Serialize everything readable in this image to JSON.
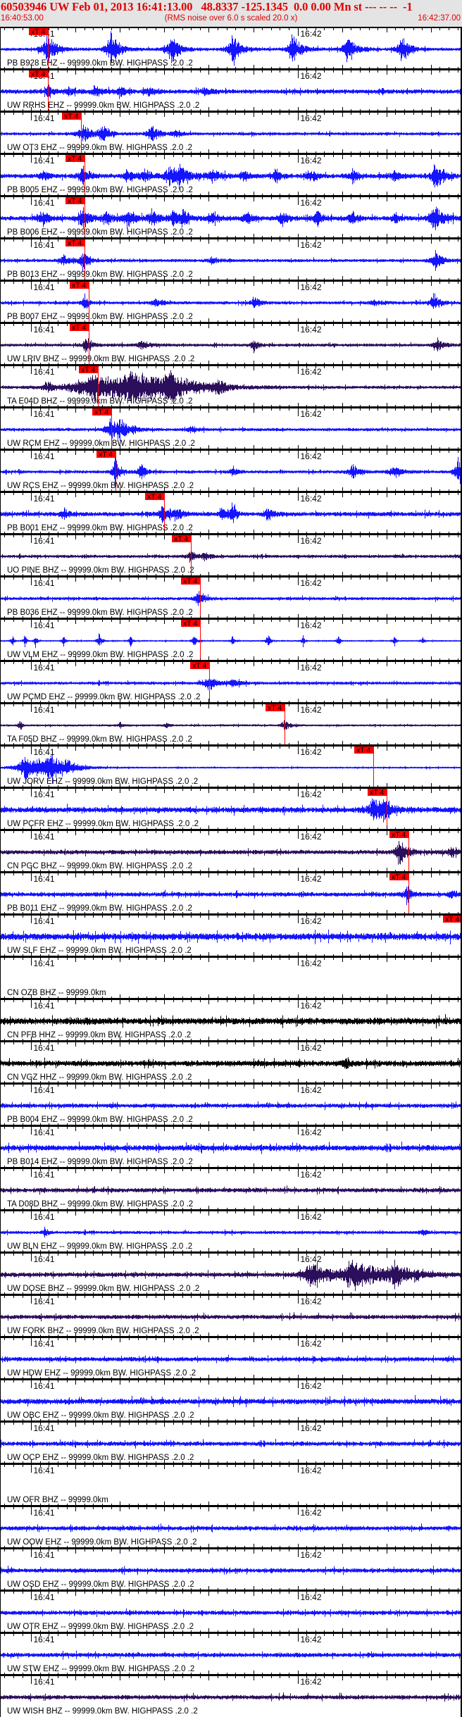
{
  "header": {
    "title": "60503946 UW Feb 01, 2013 16:41:13.00   48.8337 -125.1345  0.0 0.00 Mn st --- -- --  -1",
    "start_time": "16:40:53.00",
    "note": "(RMS noise over 6.0 s scaled 20.0 x)",
    "end_time": "16:42:37.00",
    "text_color": "#e00000",
    "background": "#e4e4e4"
  },
  "chart_data": {
    "type": "line",
    "x_axis": {
      "range": [
        "16:40:53.00",
        "16:42:37.00"
      ],
      "minor_tick_s": 2,
      "major_tick_s": 10,
      "tick_labels": [
        "16:41",
        "16:42"
      ]
    },
    "pick_label": "xT 4",
    "pick_color": "#ff0000",
    "panels": [
      {
        "label": "PB B928 EHZ -- 99999.0km BW. HIGHPASS .2.0 .2",
        "color": "#1414ff",
        "pick": "16:41:03.8"
      },
      {
        "label": "UW RRHS EHZ -- 99999.0km BW. HIGHPASS .2.0 .2",
        "color": "#1414ff",
        "pick": "16:41:03.8"
      },
      {
        "label": "UW OT3 EHZ -- 99999.0km BW. HIGHPASS .2.0 .2",
        "color": "#1414ff",
        "pick": "16:41:11.2"
      },
      {
        "label": "PB B005 EHZ -- 99999.0km BW. HIGHPASS .2.0 .2",
        "color": "#1414ff",
        "pick": "16:41:12.0"
      },
      {
        "label": "PB B006 EHZ -- 99999.0km BW. HIGHPASS .2.0 .2",
        "color": "#1414ff",
        "pick": "16:41:12.0"
      },
      {
        "label": "PB B013 EHZ -- 99999.0km BW. HIGHPASS .2.0 .2",
        "color": "#1414ff",
        "pick": "16:41:12.0"
      },
      {
        "label": "PB B007 EHZ -- 99999.0km BW. HIGHPASS .2.0 .2",
        "color": "#1414ff",
        "pick": "16:41:13.0"
      },
      {
        "label": "UW LRIV BHZ -- 99999.0km BW. HIGHPASS .2.0 .2",
        "color": "#2b0f5c",
        "pick": "16:41:13.0"
      },
      {
        "label": "TA E04D BHZ -- 99999.0km BW. HIGHPASS .2.0 .2",
        "color": "#2b0f5c",
        "pick": "16:41:15.0"
      },
      {
        "label": "UW RCM EHZ -- 99999.0km BW. HIGHPASS .2.0 .2",
        "color": "#1414ff",
        "pick": "16:41:18.0"
      },
      {
        "label": "UW RCS EHZ -- 99999.0km BW. HIGHPASS .2.0 .2",
        "color": "#1414ff",
        "pick": "16:41:19.0"
      },
      {
        "label": "PB B001 EHZ -- 99999.0km BW. HIGHPASS .2.0 .2",
        "color": "#1414ff",
        "pick": "16:41:29.9"
      },
      {
        "label": "UO PINE BHZ -- 99999.0km BW. HIGHPASS .2.0 .2",
        "color": "#2b0f5c",
        "pick": "16:41:36.0"
      },
      {
        "label": "PB B036 EHZ -- 99999.0km BW. HIGHPASS .2.0 .2",
        "color": "#1414ff",
        "pick": "16:41:38.0"
      },
      {
        "label": "UW VLM EHZ -- 99999.0km BW. HIGHPASS .2.0 .2",
        "color": "#1414ff",
        "pick": "16:41:38.0"
      },
      {
        "label": "UW PCMD EHZ -- 99999.0km BW. HIGHPASS .2.0 .2",
        "color": "#1414ff",
        "pick": "16:41:40.1"
      },
      {
        "label": "TA F05D BHZ -- 99999.0km BW. HIGHPASS .2.0 .2",
        "color": "#2b0f5c",
        "pick": "16:41:57.0"
      },
      {
        "label": "UW JORV EHZ -- 99999.0km BW. HIGHPASS .2.0 .2",
        "color": "#1414ff",
        "pick": "16:42:17.0"
      },
      {
        "label": "UW PCFR EHZ -- 99999.0km BW. HIGHPASS .2.0 .2",
        "color": "#1414ff",
        "pick": "16:42:20.0"
      },
      {
        "label": "CN PGC BHZ -- 99999.0km BW. HIGHPASS .2.0 .2",
        "color": "#2b0f5c",
        "pick": "16:42:25.0"
      },
      {
        "label": "PB B011 EHZ -- 99999.0km BW. HIGHPASS .2.0 .2",
        "color": "#1414ff",
        "pick": "16:42:25.0"
      },
      {
        "label": "UW SLF EHZ -- 99999.0km BW. HIGHPASS .2.0 .2",
        "color": "#1414ff",
        "pick": "16:42:37.0"
      },
      {
        "label": "CN OZB BHZ -- 99999.0km",
        "color": "#000000",
        "pick": null
      },
      {
        "label": "CN PFB HHZ -- 99999.0km BW. HIGHPASS .2.0 .2",
        "color": "#000000",
        "pick": null
      },
      {
        "label": "CN VGZ HHZ -- 99999.0km BW. HIGHPASS .2.0 .2",
        "color": "#000000",
        "pick": null
      },
      {
        "label": "PB B004 EHZ -- 99999.0km BW. HIGHPASS .2.0 .2",
        "color": "#1414ff",
        "pick": null
      },
      {
        "label": "PB B014 EHZ -- 99999.0km BW. HIGHPASS .2.0 .2",
        "color": "#1414ff",
        "pick": null
      },
      {
        "label": "TA D08D BHZ -- 99999.0km BW. HIGHPASS .2.0 .2",
        "color": "#2b0f5c",
        "pick": null
      },
      {
        "label": "UW BLN EHZ -- 99999.0km BW. HIGHPASS .2.0 .2",
        "color": "#1414ff",
        "pick": null
      },
      {
        "label": "UW DOSE BHZ -- 99999.0km BW. HIGHPASS .2.0 .2",
        "color": "#2b0f5c",
        "pick": null
      },
      {
        "label": "UW FORK BHZ -- 99999.0km BW. HIGHPASS .2.0 .2",
        "color": "#2b0f5c",
        "pick": null
      },
      {
        "label": "UW HDW EHZ -- 99999.0km BW. HIGHPASS .2.0 .2",
        "color": "#1414ff",
        "pick": null
      },
      {
        "label": "UW OBC EHZ -- 99999.0km BW. HIGHPASS .2.0 .2",
        "color": "#1414ff",
        "pick": null
      },
      {
        "label": "UW OCP EHZ -- 99999.0km BW. HIGHPASS .2.0 .2",
        "color": "#1414ff",
        "pick": null
      },
      {
        "label": "UW OFR BHZ -- 99999.0km",
        "color": "#1414ff",
        "pick": null
      },
      {
        "label": "UW OOW EHZ -- 99999.0km BW. HIGHPASS .2.0 .2",
        "color": "#1414ff",
        "pick": null
      },
      {
        "label": "UW OSD EHZ -- 99999.0km BW. HIGHPASS .2.0 .2",
        "color": "#1414ff",
        "pick": null
      },
      {
        "label": "UW OTR EHZ -- 99999.0km BW. HIGHPASS .2.0 .2",
        "color": "#1414ff",
        "pick": null
      },
      {
        "label": "UW STW EHZ -- 99999.0km BW. HIGHPASS .2.0 .2",
        "color": "#1414ff",
        "pick": null
      },
      {
        "label": "UW WISH BHZ -- 99999.0km BW. HIGHPASS .2.0 .2",
        "color": "#2b0f5c",
        "pick": null
      }
    ]
  }
}
